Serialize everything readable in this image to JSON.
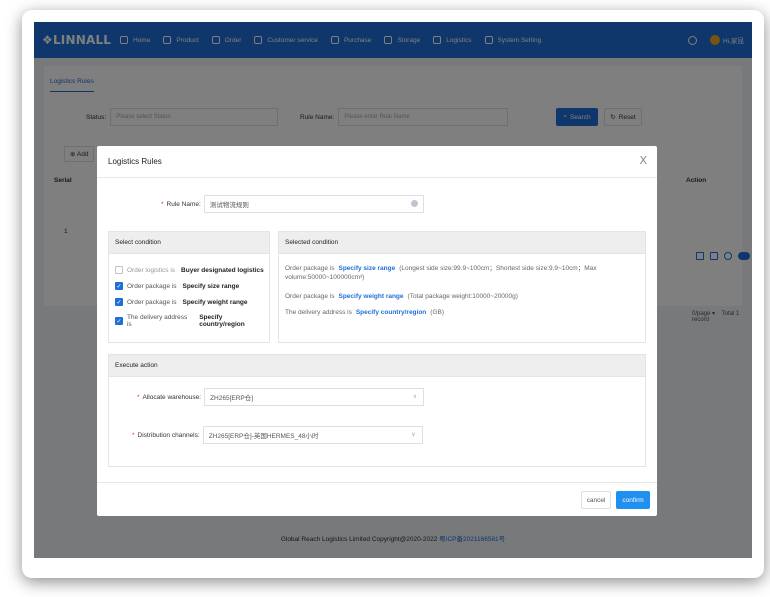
{
  "brand": {
    "logo": "❖LINNALL",
    "accent": "#1f6fd6"
  },
  "nav": [
    {
      "label": "Home",
      "icon": "home-icon"
    },
    {
      "label": "Product",
      "icon": "product-icon"
    },
    {
      "label": "Order",
      "icon": "order-icon"
    },
    {
      "label": "Customer service",
      "icon": "user-icon"
    },
    {
      "label": "Purchase",
      "icon": "bag-icon"
    },
    {
      "label": "Storage",
      "icon": "storage-icon"
    },
    {
      "label": "Logistics",
      "icon": "truck-icon"
    },
    {
      "label": "System Setting",
      "icon": "gear-icon"
    }
  ],
  "user": {
    "name": "Hi,家昆"
  },
  "page": {
    "tab": "Logistics Rules",
    "status_label": "Status:",
    "status_placeholder": "Please select Status",
    "rule_name_label": "Rule Name:",
    "rule_name_placeholder": "Please enter Rule Name",
    "search_label": "Search",
    "reset_label": "Reset",
    "add_label": "Add",
    "col_serial": "Serial",
    "col_action": "Action",
    "row_serial": "1",
    "pager_size": "0/page",
    "pager_total": "Total 1 record"
  },
  "footer": {
    "text": "Global Reach Logistics Limited Copyright@2020-2022 ",
    "icp": "粤ICP备2021166581号"
  },
  "modal": {
    "title": "Logistics Rules",
    "close": "X",
    "rule_name_label": "Rule Name:",
    "rule_name_value": "测试物流规则",
    "select_condition_title": "Select condition",
    "selected_condition_title": "Selected condition",
    "conditions": [
      {
        "prefix": "Order logistics is",
        "value": "Buyer designated logistics",
        "checked": false
      },
      {
        "prefix": "Order package is",
        "value": "Specify size range",
        "checked": true
      },
      {
        "prefix": "Order package is",
        "value": "Specify weight range",
        "checked": true
      },
      {
        "prefix": "The delivery address is",
        "value": "Specify country/region",
        "checked": true
      }
    ],
    "selected": [
      {
        "prefix": "Order package is",
        "link": "Specify size range",
        "detail": "(Longest side size:99.9~100cm；Shortest side size:9.9~10cm；Max volume:50000~100000cm³)"
      },
      {
        "prefix": "Order package is",
        "link": "Specify weight range",
        "detail": "(Total package weight:10000~20000g)"
      },
      {
        "prefix": "The delivery address is",
        "link": "Specify country/region",
        "detail": "(GB)"
      }
    ],
    "execute_title": "Execute action",
    "warehouse_label": "Allocate warehouse:",
    "warehouse_value": "ZH265[ERP仓]",
    "channel_label": "Distribution channels:",
    "channel_value": "ZH265[ERP仓]-英国HERMES_48小时",
    "cancel_label": "cancel",
    "confirm_label": "confirm"
  }
}
